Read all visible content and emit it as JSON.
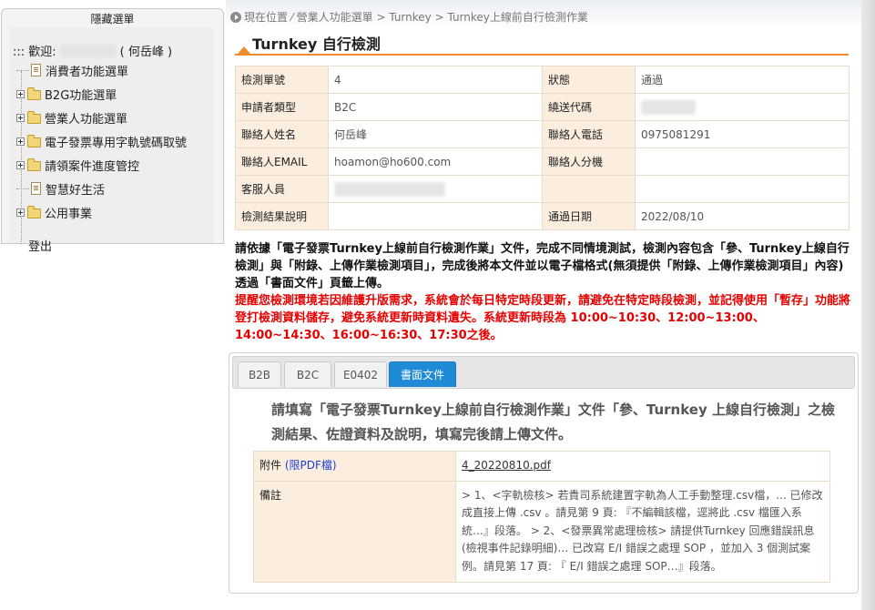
{
  "sidebar": {
    "header": "隱藏選單",
    "welcome_prefix": "::: 歡迎:",
    "welcome_user": "( 何岳峰 )",
    "items": [
      {
        "label": "消費者功能選單"
      },
      {
        "label": "B2G功能選單"
      },
      {
        "label": "營業人功能選單"
      },
      {
        "label": "電子發票專用字軌號碼取號"
      },
      {
        "label": "請領案件進度管控"
      },
      {
        "label": "智慧好生活"
      },
      {
        "label": "公用事業"
      }
    ],
    "logout": "登出"
  },
  "breadcrumb": "現在位置 ⁄ 營業人功能選單 > Turnkey > Turnkey上線前自行檢測作業",
  "page_title": "Turnkey 自行檢測",
  "info": {
    "r1": {
      "k1": "檢測單號",
      "v1": "4",
      "k2": "狀態",
      "v2": "通過"
    },
    "r2": {
      "k1": "申請者類型",
      "v1": "B2C",
      "k2": "繞送代碼",
      "v2": ""
    },
    "r3": {
      "k1": "聯絡人姓名",
      "v1": "何岳峰",
      "k2": "聯絡人電話",
      "v2": "0975081291"
    },
    "r4": {
      "k1": "聯絡人EMAIL",
      "v1": "hoamon@ho600.com",
      "k2": "聯絡人分機",
      "v2": ""
    },
    "r5": {
      "k1": "客服人員",
      "v1": "",
      "k2": "",
      "v2": ""
    },
    "r6": {
      "k1": "檢測結果說明",
      "v1": "",
      "k2": "通過日期",
      "v2": "2022/08/10"
    }
  },
  "notice_black": "請依據「電子發票Turnkey上線前自行檢測作業」文件，完成不同情境測試，檢測內容包含「參、Turnkey上線自行檢測」與「附錄、上傳作業檢測項目」，完成後將本文件並以電子檔格式(無須提供「附錄、上傳作業檢測項目」內容)透過「書面文件」頁籤上傳。",
  "notice_red": "提醒您檢測環境若因維護升版需求，系統會於每日特定時段更新，請避免在特定時段檢測，並記得使用「暫存」功能將登打檢測資料儲存，避免系統更新時資料遺失。系統更新時段為 10:00~10:30、12:00~13:00、14:00~14:30、16:00~16:30、17:30之後。",
  "tabs": [
    {
      "label": "B2B"
    },
    {
      "label": "B2C"
    },
    {
      "label": "E0402"
    },
    {
      "label": "書面文件"
    }
  ],
  "upload_instruction": "請填寫「電子發票Turnkey上線前自行檢測作業」文件「參、Turnkey 上線自行檢測」之檢測結果、佐證資料及說明，填寫完後請上傳文件。",
  "attach": {
    "label": "附件",
    "pdf_hint": "(限PDF檔)",
    "file": "4_20220810.pdf",
    "note_label": "備註",
    "note_text": "> 1、<字軌檢核> 若貴司系統建置字軌為人工手動整理.csv檔，... 已修改成直接上傳 .csv 。請見第 9 頁: 『不編輯該檔，逕將此 .csv 檔匯入系統…』段落。 > 2、<發票異常處理檢核> 請提供Turnkey 回應錯誤訊息(檢視事件記錄明細)… 已改寫 E/I 錯誤之處理 SOP ，並加入 3 個測試案例。請見第 17 頁: 『 E/I 錯誤之處理 SOP…』段落。"
  },
  "colors": {
    "accent_orange": "#f08b2c",
    "tab_active": "#1f8ad6",
    "key_cell": "#fbeede",
    "notice_red": "#e60000"
  }
}
